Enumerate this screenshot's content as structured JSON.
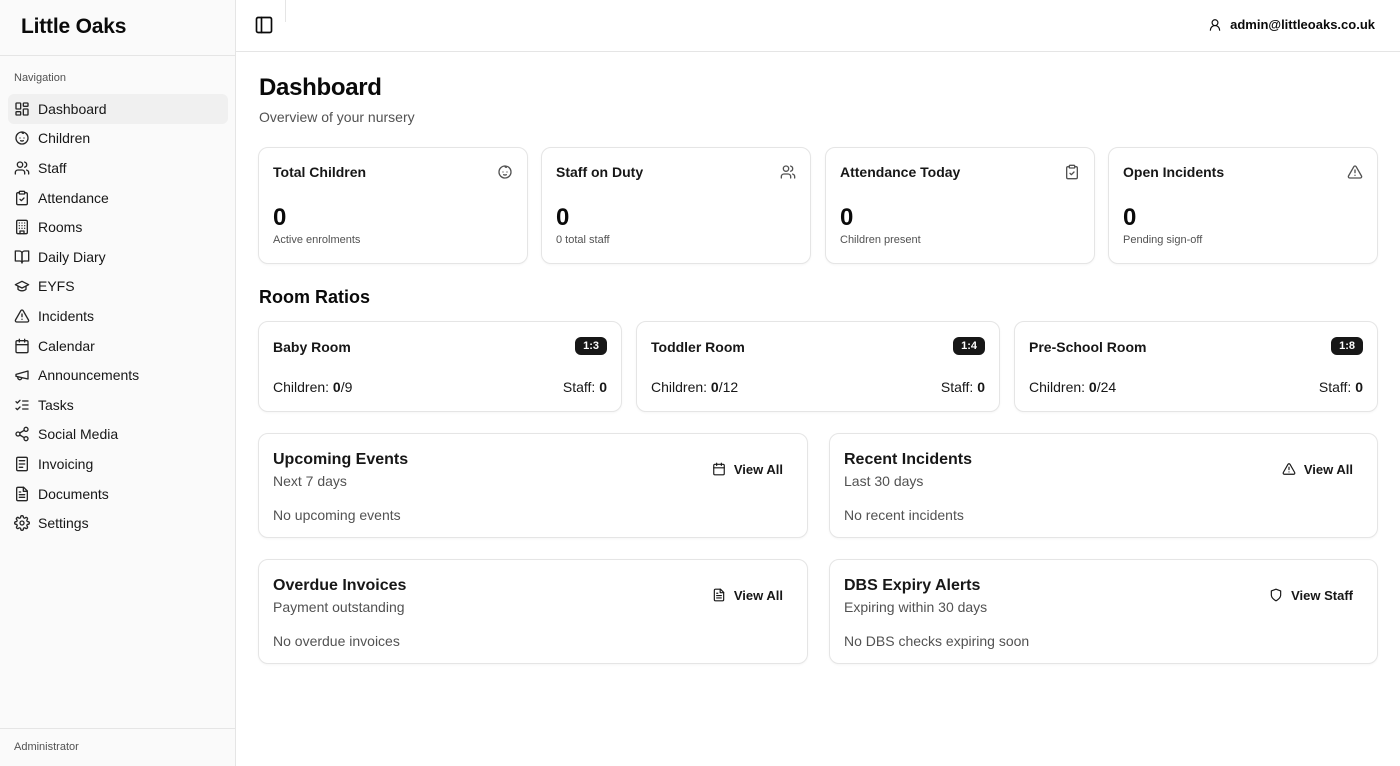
{
  "app": {
    "name": "Little Oaks"
  },
  "sidebar": {
    "section_label": "Navigation",
    "items": [
      {
        "label": "Dashboard",
        "icon": "dashboard-icon",
        "active": true
      },
      {
        "label": "Children",
        "icon": "baby-icon"
      },
      {
        "label": "Staff",
        "icon": "users-icon"
      },
      {
        "label": "Attendance",
        "icon": "clipboard-check-icon"
      },
      {
        "label": "Rooms",
        "icon": "building-icon"
      },
      {
        "label": "Daily Diary",
        "icon": "book-open-icon"
      },
      {
        "label": "EYFS",
        "icon": "graduation-cap-icon"
      },
      {
        "label": "Incidents",
        "icon": "alert-triangle-icon"
      },
      {
        "label": "Calendar",
        "icon": "calendar-icon"
      },
      {
        "label": "Announcements",
        "icon": "megaphone-icon"
      },
      {
        "label": "Tasks",
        "icon": "list-checks-icon"
      },
      {
        "label": "Social Media",
        "icon": "share-icon"
      },
      {
        "label": "Invoicing",
        "icon": "receipt-icon"
      },
      {
        "label": "Documents",
        "icon": "file-text-icon"
      },
      {
        "label": "Settings",
        "icon": "gear-icon"
      }
    ],
    "footer": "Administrator"
  },
  "header": {
    "user_email": "admin@littleoaks.co.uk"
  },
  "page": {
    "title": "Dashboard",
    "subtitle": "Overview of your nursery"
  },
  "stats": [
    {
      "title": "Total Children",
      "value": "0",
      "sub": "Active enrolments",
      "icon": "baby-icon"
    },
    {
      "title": "Staff on Duty",
      "value": "0",
      "sub": "0 total staff",
      "icon": "users-icon"
    },
    {
      "title": "Attendance Today",
      "value": "0",
      "sub": "Children present",
      "icon": "clipboard-check-icon"
    },
    {
      "title": "Open Incidents",
      "value": "0",
      "sub": "Pending sign-off",
      "icon": "alert-triangle-icon"
    }
  ],
  "room_ratios": {
    "title": "Room Ratios",
    "children_label": "Children:",
    "staff_label": "Staff:",
    "rooms": [
      {
        "name": "Baby Room",
        "ratio": "1:3",
        "children": "0",
        "capacity": "/9",
        "staff": "0"
      },
      {
        "name": "Toddler Room",
        "ratio": "1:4",
        "children": "0",
        "capacity": "/12",
        "staff": "0"
      },
      {
        "name": "Pre-School Room",
        "ratio": "1:8",
        "children": "0",
        "capacity": "/24",
        "staff": "0"
      }
    ]
  },
  "panels": [
    {
      "title": "Upcoming Events",
      "subtitle": "Next 7 days",
      "empty": "No upcoming events",
      "button": "View All",
      "icon": "calendar-icon"
    },
    {
      "title": "Recent Incidents",
      "subtitle": "Last 30 days",
      "empty": "No recent incidents",
      "button": "View All",
      "icon": "alert-triangle-icon"
    },
    {
      "title": "Overdue Invoices",
      "subtitle": "Payment outstanding",
      "empty": "No overdue invoices",
      "button": "View All",
      "icon": "file-text-icon"
    },
    {
      "title": "DBS Expiry Alerts",
      "subtitle": "Expiring within 30 days",
      "empty": "No DBS checks expiring soon",
      "button": "View Staff",
      "icon": "shield-icon"
    }
  ]
}
